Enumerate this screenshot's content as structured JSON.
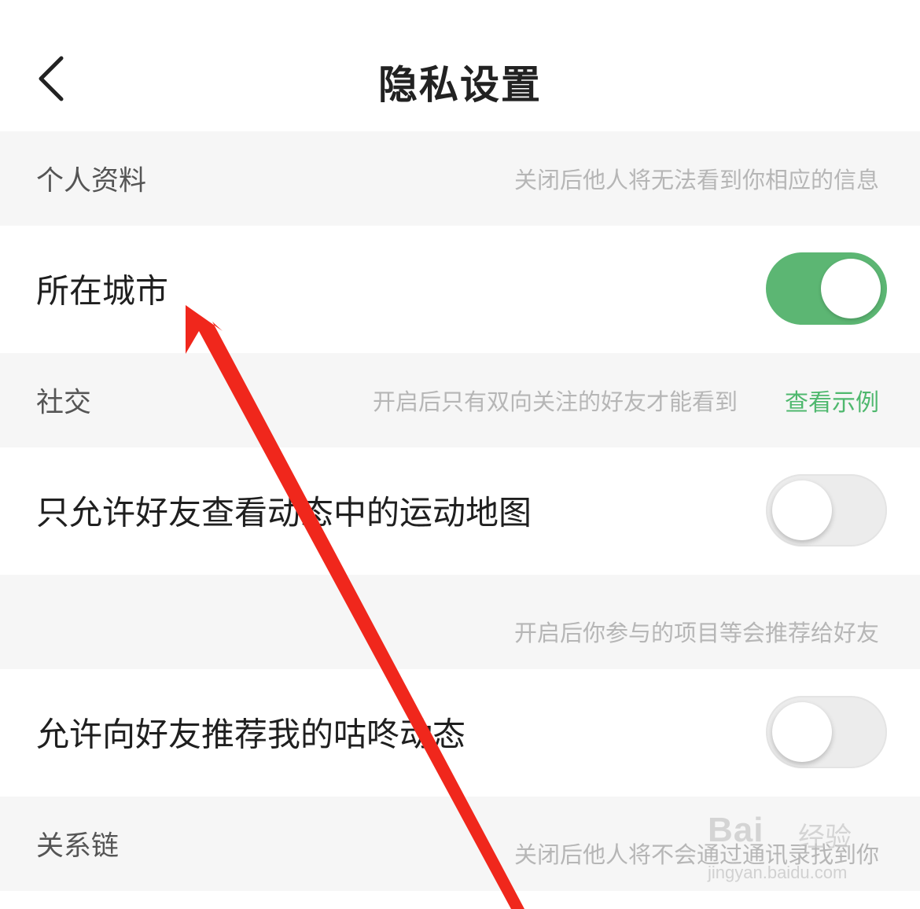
{
  "header": {
    "title": "隐私设置",
    "back_icon": "chevron-left-icon"
  },
  "sections": [
    {
      "label": "个人资料",
      "hint": "关闭后他人将无法看到你相应的信息"
    },
    {
      "label": "社交",
      "hint": "开启后只有双向关注的好友才能看到",
      "link": "查看示例"
    },
    {
      "label": "",
      "hint": "开启后你参与的项目等会推荐给好友"
    },
    {
      "label": "关系链",
      "hint": "关闭后他人将不会通过通讯录找到你"
    }
  ],
  "rows": [
    {
      "label": "所在城市",
      "toggle_on": true
    },
    {
      "label": "只允许好友查看动态中的运动地图",
      "toggle_on": false
    },
    {
      "label": "允许向好友推荐我的咕咚动态",
      "toggle_on": false
    }
  ],
  "annotation": {
    "type": "arrow",
    "color": "#f0271c"
  },
  "watermark": {
    "brand": "Bai",
    "sub": "经验",
    "url": "jingyan.baidu.com"
  },
  "colors": {
    "accent": "#5cb673",
    "link": "#4fb86e",
    "section_bg": "#f6f6f6"
  }
}
